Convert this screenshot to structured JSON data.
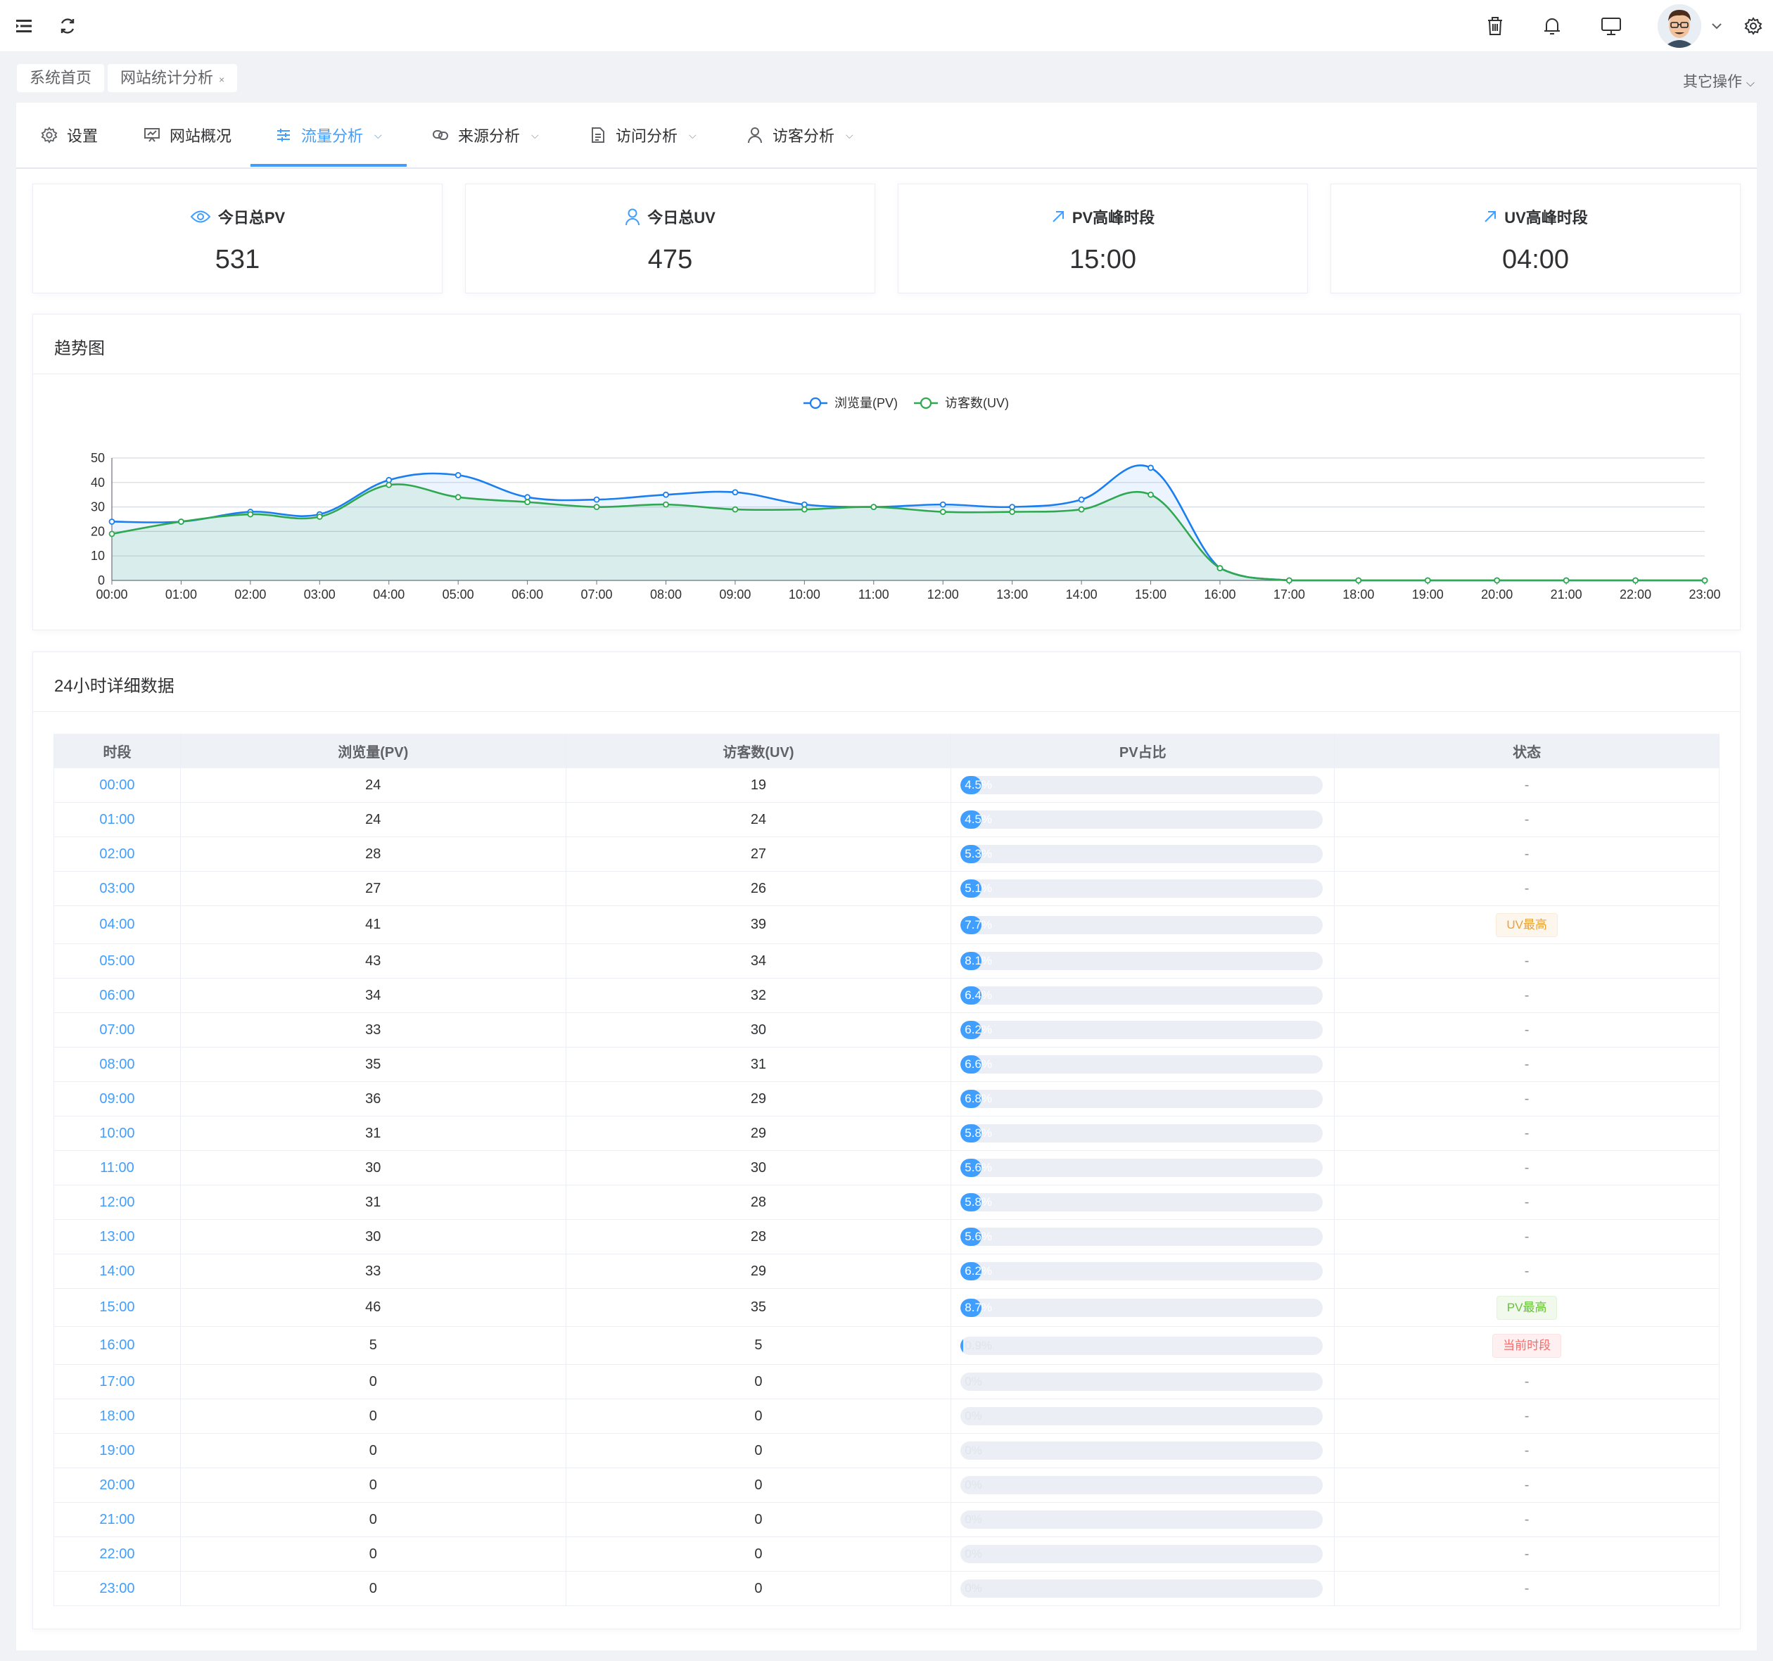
{
  "header": {
    "menu_icon": "menu-fold-icon",
    "refresh_icon": "refresh-icon",
    "delete_icon": "trash-icon",
    "bell_icon": "bell-icon",
    "screen_icon": "monitor-icon",
    "settings_icon": "gear-icon"
  },
  "tags": [
    {
      "label": "系统首页"
    },
    {
      "label": "网站统计分析",
      "close": "×"
    }
  ],
  "other_ops": "其它操作",
  "tabs": [
    {
      "label": "设置",
      "icon": "gear-icon"
    },
    {
      "label": "网站概况",
      "icon": "presentation-icon"
    },
    {
      "label": "流量分析",
      "icon": "sliders-icon",
      "active": true
    },
    {
      "label": "来源分析",
      "icon": "link-icon"
    },
    {
      "label": "访问分析",
      "icon": "document-icon"
    },
    {
      "label": "访客分析",
      "icon": "user-icon"
    }
  ],
  "stats": [
    {
      "label": "今日总PV",
      "value": "531",
      "icon": "eye-icon"
    },
    {
      "label": "今日总UV",
      "value": "475",
      "icon": "user-icon"
    },
    {
      "label": "PV高峰时段",
      "value": "15:00",
      "icon": "arrow-up-right-icon"
    },
    {
      "label": "UV高峰时段",
      "value": "04:00",
      "icon": "arrow-up-right-icon"
    }
  ],
  "trend_title": "趋势图",
  "detail_title": "24小时详细数据",
  "colors": {
    "accent": "#409eff",
    "pv": "#1a7ef0",
    "uv": "#2fa84f"
  },
  "chart_data": {
    "type": "line",
    "title": "",
    "xlabel": "",
    "ylabel": "",
    "ylim": [
      0,
      50
    ],
    "yticks": [
      "0",
      "10",
      "20",
      "30",
      "40",
      "50"
    ],
    "x": [
      "00:00",
      "01:00",
      "02:00",
      "03:00",
      "04:00",
      "05:00",
      "06:00",
      "07:00",
      "08:00",
      "09:00",
      "10:00",
      "11:00",
      "12:00",
      "13:00",
      "14:00",
      "15:00",
      "16:00",
      "17:00",
      "18:00",
      "19:00",
      "20:00",
      "21:00",
      "22:00",
      "23:00"
    ],
    "legend_position": "top-center",
    "grid": true,
    "series": [
      {
        "name": "浏览量(PV)",
        "values": [
          24,
          24,
          28,
          27,
          41,
          43,
          34,
          33,
          35,
          36,
          31,
          30,
          31,
          30,
          33,
          46,
          5,
          0,
          0,
          0,
          0,
          0,
          0,
          0
        ]
      },
      {
        "name": "访客数(UV)",
        "values": [
          19,
          24,
          27,
          26,
          39,
          34,
          32,
          30,
          31,
          29,
          29,
          30,
          28,
          28,
          29,
          35,
          5,
          0,
          0,
          0,
          0,
          0,
          0,
          0
        ]
      }
    ]
  },
  "table": {
    "columns": [
      "时段",
      "浏览量(PV)",
      "访客数(UV)",
      "PV占比",
      "状态"
    ],
    "rows": [
      {
        "time": "00:00",
        "pv": "24",
        "uv": "19",
        "pct": "4.5%",
        "ratio": 0.045,
        "status": "-"
      },
      {
        "time": "01:00",
        "pv": "24",
        "uv": "24",
        "pct": "4.5%",
        "ratio": 0.045,
        "status": "-"
      },
      {
        "time": "02:00",
        "pv": "28",
        "uv": "27",
        "pct": "5.3%",
        "ratio": 0.053,
        "status": "-"
      },
      {
        "time": "03:00",
        "pv": "27",
        "uv": "26",
        "pct": "5.1%",
        "ratio": 0.051,
        "status": "-"
      },
      {
        "time": "04:00",
        "pv": "41",
        "uv": "39",
        "pct": "7.7%",
        "ratio": 0.077,
        "status": "UV最高",
        "badge": "warn"
      },
      {
        "time": "05:00",
        "pv": "43",
        "uv": "34",
        "pct": "8.1%",
        "ratio": 0.081,
        "status": "-"
      },
      {
        "time": "06:00",
        "pv": "34",
        "uv": "32",
        "pct": "6.4%",
        "ratio": 0.064,
        "status": "-"
      },
      {
        "time": "07:00",
        "pv": "33",
        "uv": "30",
        "pct": "6.2%",
        "ratio": 0.062,
        "status": "-"
      },
      {
        "time": "08:00",
        "pv": "35",
        "uv": "31",
        "pct": "6.6%",
        "ratio": 0.066,
        "status": "-"
      },
      {
        "time": "09:00",
        "pv": "36",
        "uv": "29",
        "pct": "6.8%",
        "ratio": 0.068,
        "status": "-"
      },
      {
        "time": "10:00",
        "pv": "31",
        "uv": "29",
        "pct": "5.8%",
        "ratio": 0.058,
        "status": "-"
      },
      {
        "time": "11:00",
        "pv": "30",
        "uv": "30",
        "pct": "5.6%",
        "ratio": 0.056,
        "status": "-"
      },
      {
        "time": "12:00",
        "pv": "31",
        "uv": "28",
        "pct": "5.8%",
        "ratio": 0.058,
        "status": "-"
      },
      {
        "time": "13:00",
        "pv": "30",
        "uv": "28",
        "pct": "5.6%",
        "ratio": 0.056,
        "status": "-"
      },
      {
        "time": "14:00",
        "pv": "33",
        "uv": "29",
        "pct": "6.2%",
        "ratio": 0.062,
        "status": "-"
      },
      {
        "time": "15:00",
        "pv": "46",
        "uv": "35",
        "pct": "8.7%",
        "ratio": 0.087,
        "status": "PV最高",
        "badge": "success"
      },
      {
        "time": "16:00",
        "pv": "5",
        "uv": "5",
        "pct": "0.9%",
        "ratio": 0.009,
        "status": "当前时段",
        "badge": "danger"
      },
      {
        "time": "17:00",
        "pv": "0",
        "uv": "0",
        "pct": "0%",
        "ratio": 0,
        "status": "-"
      },
      {
        "time": "18:00",
        "pv": "0",
        "uv": "0",
        "pct": "0%",
        "ratio": 0,
        "status": "-"
      },
      {
        "time": "19:00",
        "pv": "0",
        "uv": "0",
        "pct": "0%",
        "ratio": 0,
        "status": "-"
      },
      {
        "time": "20:00",
        "pv": "0",
        "uv": "0",
        "pct": "0%",
        "ratio": 0,
        "status": "-"
      },
      {
        "time": "21:00",
        "pv": "0",
        "uv": "0",
        "pct": "0%",
        "ratio": 0,
        "status": "-"
      },
      {
        "time": "22:00",
        "pv": "0",
        "uv": "0",
        "pct": "0%",
        "ratio": 0,
        "status": "-"
      },
      {
        "time": "23:00",
        "pv": "0",
        "uv": "0",
        "pct": "0%",
        "ratio": 0,
        "status": "-"
      }
    ]
  }
}
